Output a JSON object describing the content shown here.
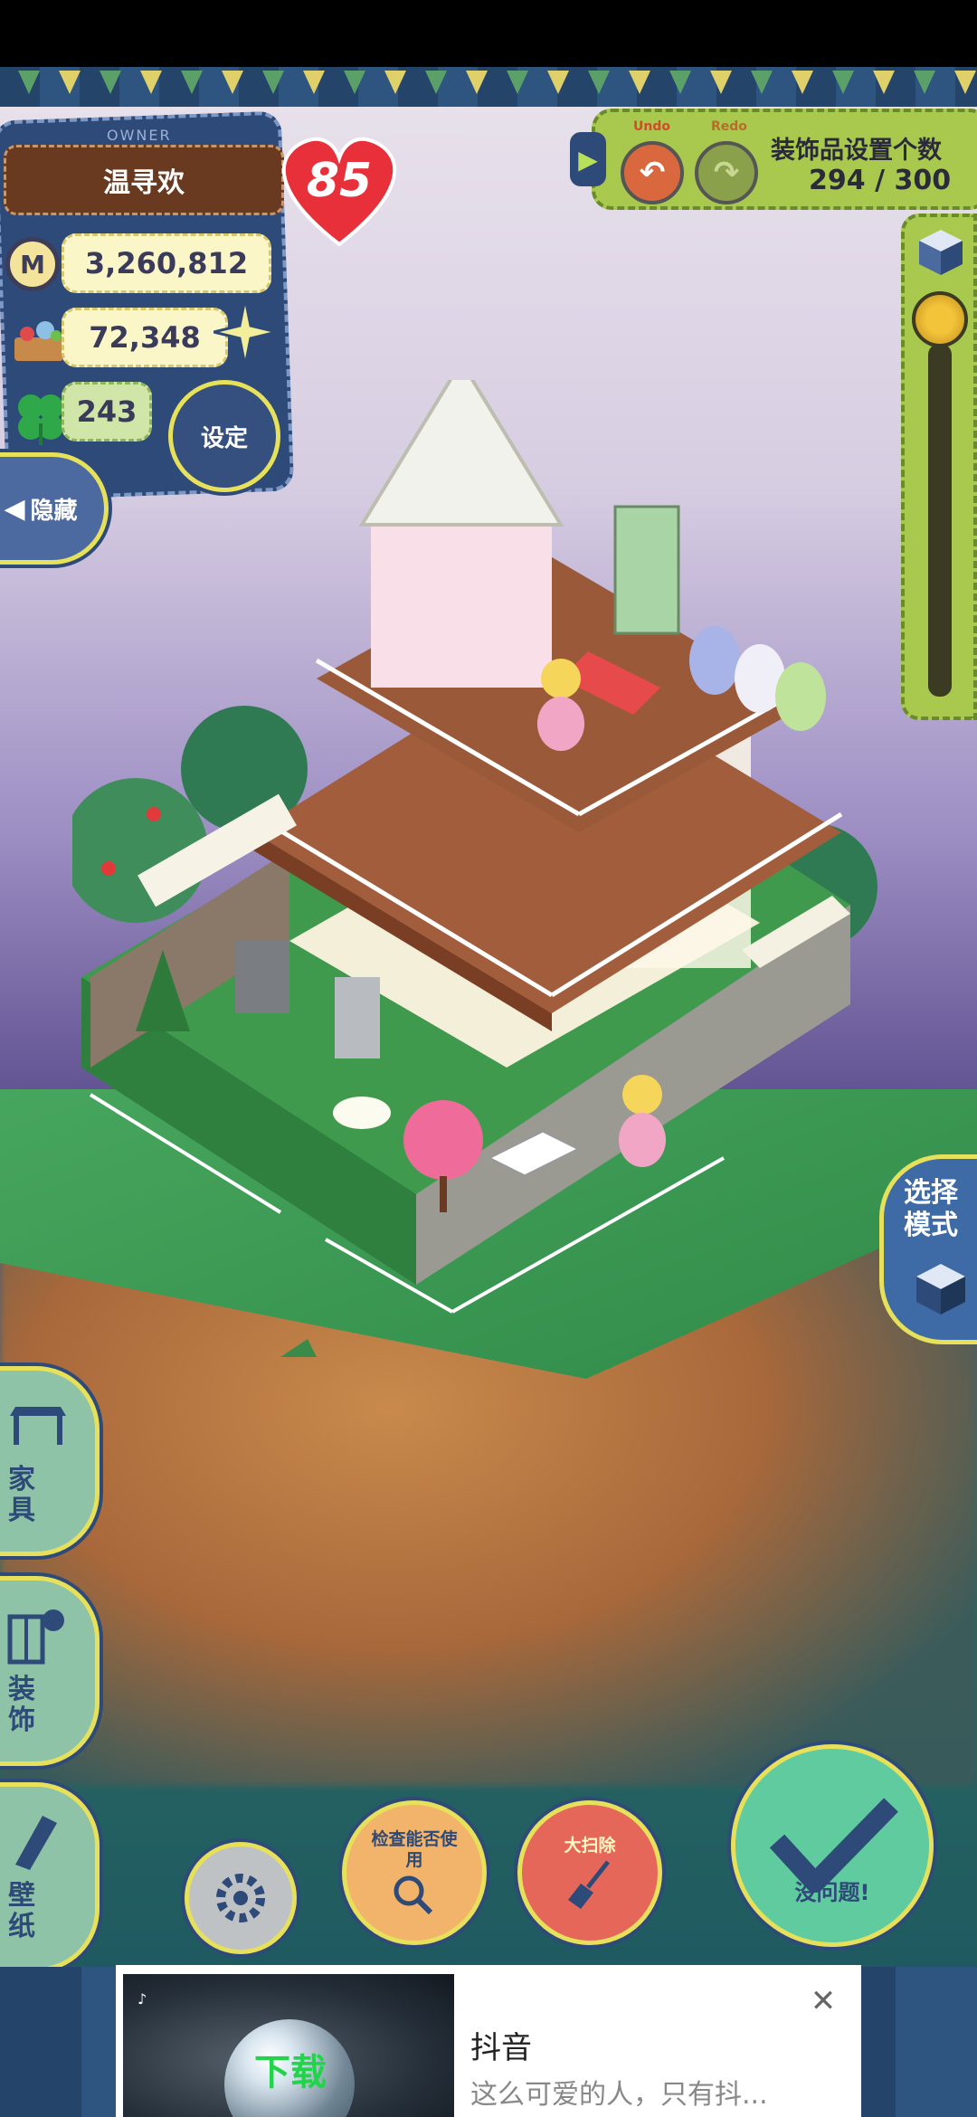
{
  "owner": {
    "tag": "OWNER",
    "name": "温寻欢",
    "level": "85"
  },
  "stats": {
    "coins": "3,260,812",
    "food": "72,348",
    "clover": "243"
  },
  "buttons": {
    "settings": "设定",
    "hide": "隐藏",
    "undo_label": "Undo",
    "redo_label": "Redo",
    "select_mode": "选择模式",
    "furniture": "家具",
    "decor": "装饰",
    "wallpaper": "壁纸",
    "search": "检查能否使用",
    "clean": "大扫除",
    "confirm": "没问题!"
  },
  "decorations": {
    "title": "装饰品设置个数",
    "count": "294 / 300"
  },
  "ad": {
    "download_label": "下载",
    "title": "抖音",
    "description": "这么可爱的人，只有抖..."
  },
  "icons": [
    "coin-icon",
    "basket-icon",
    "clover-icon",
    "sparkle-icon",
    "gear-icon",
    "arrow-left-icon",
    "undo-icon",
    "redo-icon",
    "cube-icon",
    "zoom-knob-icon",
    "table-icon",
    "window-icon",
    "panel-icon",
    "magnifier-icon",
    "broom-icon",
    "checkmark-icon",
    "close-icon",
    "tiktok-icon"
  ],
  "colors": {
    "panel_blue": "#2e4a78",
    "accent_yellow": "#e6e05a",
    "green_bar": "#a9c94e",
    "heart_red": "#e8303a"
  }
}
